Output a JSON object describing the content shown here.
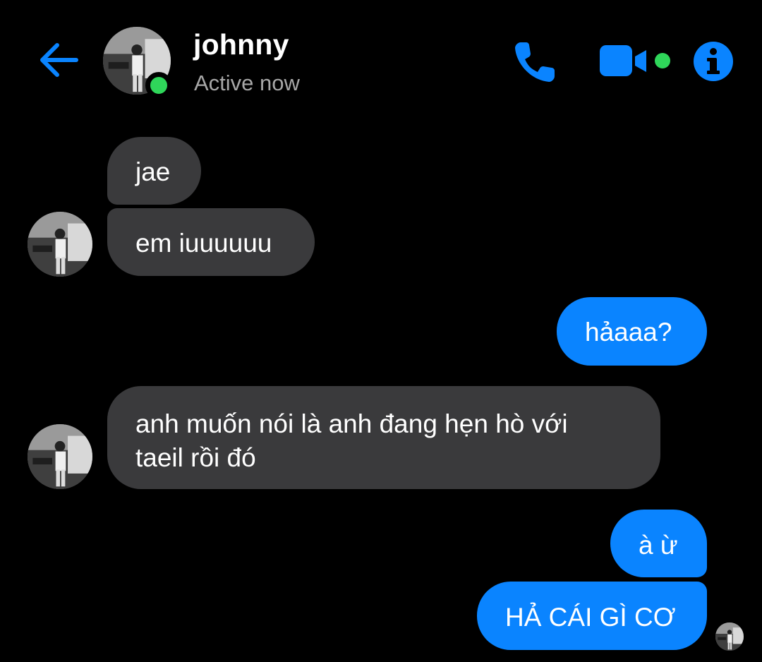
{
  "header": {
    "back_icon": "arrow-left-icon",
    "contact_name": "johnny",
    "status": "Active now",
    "online": true,
    "call_icon": "phone-icon",
    "video_icon": "video-camera-icon",
    "info_icon": "info-icon"
  },
  "colors": {
    "accent": "#0a84ff",
    "incoming_bubble": "#3a3a3c",
    "online": "#2fd65a",
    "background": "#000000"
  },
  "messages": [
    {
      "from": "them",
      "text": "jae"
    },
    {
      "from": "them",
      "text": "em iuuuuuu"
    },
    {
      "from": "me",
      "text": "hảaaa?"
    },
    {
      "from": "them",
      "line1": "anh muốn nói là anh đang hẹn hò với",
      "line2": "taeil rồi đó"
    },
    {
      "from": "me",
      "text": "à ừ"
    },
    {
      "from": "me",
      "text": "HẢ CÁI GÌ CƠ"
    }
  ]
}
